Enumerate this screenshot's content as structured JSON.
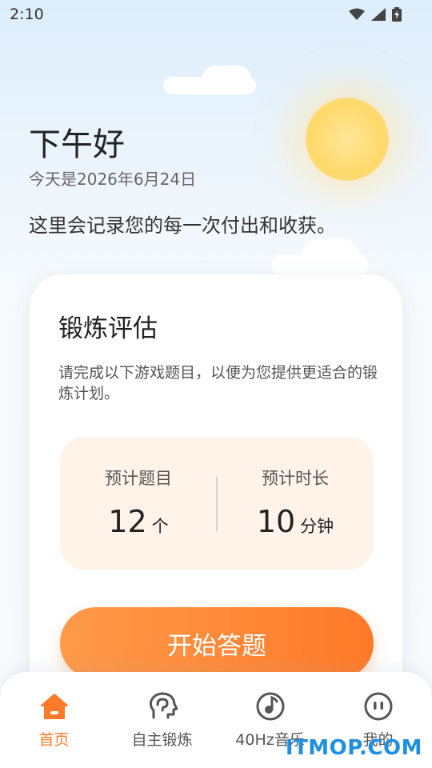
{
  "status": {
    "time": "2:10"
  },
  "header": {
    "greeting": "下午好",
    "date": "今天是2026年6月24日",
    "tagline": "这里会记录您的每一次付出和收获。"
  },
  "card": {
    "title": "锻炼评估",
    "description": "请完成以下游戏题目，以便为您提供更适合的锻炼计划。",
    "stats": [
      {
        "label": "预计题目",
        "value": "12",
        "unit": "个"
      },
      {
        "label": "预计时长",
        "value": "10",
        "unit": "分钟"
      }
    ],
    "start_button": "开始答题"
  },
  "tabs": [
    {
      "label": "首页",
      "icon": "home-icon",
      "active": true
    },
    {
      "label": "自主锻炼",
      "icon": "head-brain-icon",
      "active": false
    },
    {
      "label": "40Hz音乐",
      "icon": "music-disc-icon",
      "active": false
    },
    {
      "label": "我的",
      "icon": "profile-face-icon",
      "active": false
    }
  ],
  "watermark": "ITMOP.COM",
  "colors": {
    "accent": "#ff7a2a",
    "stat_bg": "#fff3ea",
    "sky": "#dcedfb"
  }
}
